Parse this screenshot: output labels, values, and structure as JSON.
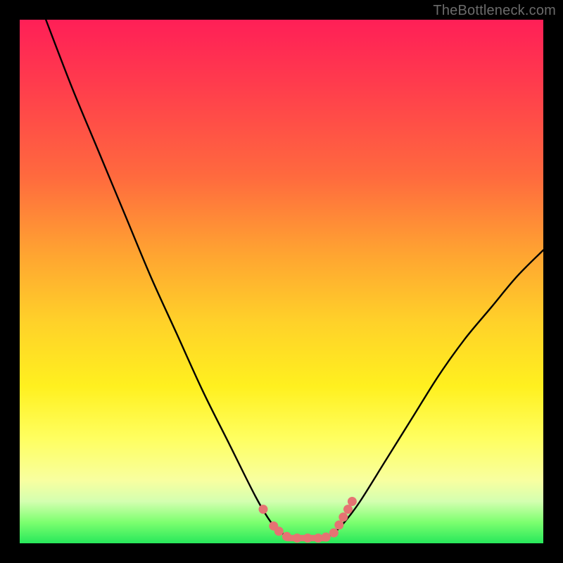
{
  "watermark": "TheBottleneck.com",
  "colors": {
    "frame": "#000000",
    "curve_stroke": "#000000",
    "dot_fill": "#e57373",
    "gradient_stops": [
      "#ff1f57",
      "#ff3b4d",
      "#ff6a3e",
      "#ffa531",
      "#ffd229",
      "#fff01f",
      "#ffff60",
      "#f8ffa0",
      "#d4ffb0",
      "#7cff6f",
      "#27e85b"
    ]
  },
  "chart_data": {
    "type": "line",
    "title": "",
    "xlabel": "",
    "ylabel": "",
    "xlim": [
      0,
      100
    ],
    "ylim": [
      0,
      100
    ],
    "grid": false,
    "legend": false,
    "annotations": [
      "TheBottleneck.com"
    ],
    "series": [
      {
        "name": "curve",
        "x": [
          5,
          10,
          15,
          20,
          25,
          30,
          35,
          40,
          45,
          48,
          50,
          52,
          55,
          58,
          60,
          62,
          65,
          70,
          75,
          80,
          85,
          90,
          95,
          100
        ],
        "y": [
          100,
          87,
          75,
          63,
          51,
          40,
          29,
          19,
          9,
          4,
          2,
          1,
          1,
          1,
          2,
          4,
          8,
          16,
          24,
          32,
          39,
          45,
          51,
          56
        ]
      }
    ],
    "dots": {
      "name": "highlight-dots",
      "x": [
        46.5,
        48.5,
        49.5,
        51,
        53,
        55,
        57,
        58.5,
        60,
        61,
        61.8,
        62.7,
        63.5
      ],
      "y": [
        6.5,
        3.3,
        2.3,
        1.3,
        1.0,
        1.0,
        1.0,
        1.2,
        2.0,
        3.5,
        5.0,
        6.5,
        8.0
      ]
    },
    "flat_bar": {
      "x_start": 50.5,
      "x_end": 59,
      "y": 1.0
    }
  }
}
